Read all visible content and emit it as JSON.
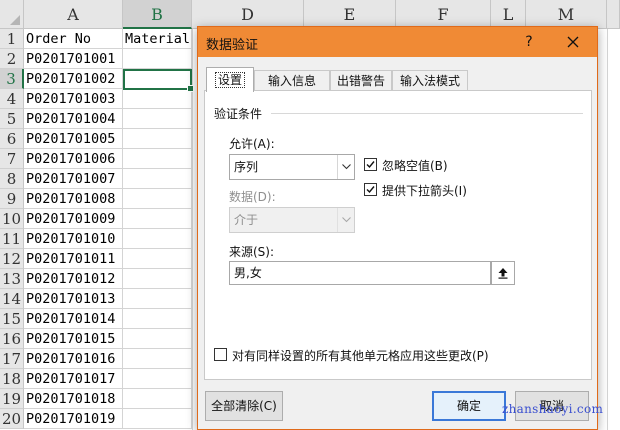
{
  "sheet": {
    "column_headers": [
      "A",
      "B",
      "D",
      "E",
      "F",
      "L",
      "M"
    ],
    "row_headers": [
      "1",
      "2",
      "3",
      "4",
      "5",
      "6",
      "7",
      "8",
      "9",
      "10",
      "11",
      "12",
      "13",
      "14",
      "15",
      "16",
      "17",
      "18",
      "19",
      "20"
    ],
    "column_a": [
      "Order No",
      "P0201701001",
      "P0201701002",
      "P0201701003",
      "P0201701004",
      "P0201701005",
      "P0201701006",
      "P0201701007",
      "P0201701008",
      "P0201701009",
      "P0201701010",
      "P0201701011",
      "P0201701012",
      "P0201701013",
      "P0201701014",
      "P0201701015",
      "P0201701016",
      "P0201701017",
      "P0201701018",
      "P0201701019"
    ],
    "b1": "Material",
    "active_cell": "B3"
  },
  "dialog": {
    "title": "数据验证",
    "help_label": "?",
    "tabs": [
      {
        "label": "设置",
        "active": true
      },
      {
        "label": "输入信息",
        "active": false
      },
      {
        "label": "出错警告",
        "active": false
      },
      {
        "label": "输入法模式",
        "active": false
      }
    ],
    "group_label": "验证条件",
    "allow_label": "允许(A):",
    "allow_value": "序列",
    "data_label": "数据(D):",
    "data_value": "介于",
    "ignore_blank": {
      "label": "忽略空值(B)",
      "checked": true
    },
    "in_cell_dropdown": {
      "label": "提供下拉箭头(I)",
      "checked": true
    },
    "source_label": "来源(S):",
    "source_value": "男,女",
    "apply_all": {
      "label": "对有同样设置的所有其他单元格应用这些更改(P)",
      "checked": false
    },
    "clear_all_button": "全部清除(C)",
    "ok_button": "确定",
    "cancel_button": "取消"
  },
  "watermark": "zhanshaoyi.com",
  "colors": {
    "dialog_title_bar": "#f08a35",
    "excel_green": "#217346",
    "primary_button_border": "#3a78d8"
  }
}
